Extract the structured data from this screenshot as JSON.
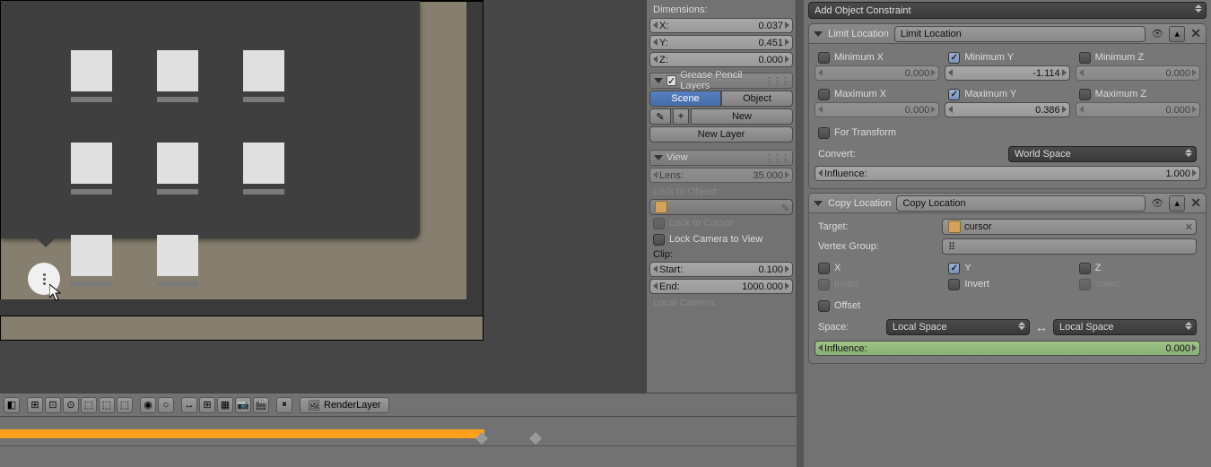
{
  "viewport": {
    "more_icon": "more-options"
  },
  "toolbar": {
    "render_layer": "RenderLayer"
  },
  "n_panel": {
    "dimensions_label": "Dimensions:",
    "dim_x_label": "X:",
    "dim_x_val": "0.037",
    "dim_y_label": "Y:",
    "dim_y_val": "0.451",
    "dim_z_label": "Z:",
    "dim_z_val": "0.000",
    "gp_header": "Grease Pencil Layers",
    "scene_btn": "Scene",
    "object_btn": "Object",
    "new_btn": "New",
    "new_layer_btn": "New Layer",
    "view_header": "View",
    "lens_label": "Lens:",
    "lens_val": "35.000",
    "lock_to_object": "Lock to Object:",
    "lock_to_cursor": "Lock to Cursor",
    "lock_camera": "Lock Camera to View",
    "clip_label": "Clip:",
    "clip_start_label": "Start:",
    "clip_start_val": "0.100",
    "clip_end_label": "End:",
    "clip_end_val": "1000.000",
    "local_camera_label": "Local Camera:"
  },
  "prop": {
    "add_constraint": "Add Object Constraint",
    "limit_loc": {
      "type_label": "Limit Location",
      "name_val": "Limit Location",
      "min_x": "Minimum X",
      "min_x_val": "0.000",
      "min_y": "Minimum Y",
      "min_y_val": "-1.114",
      "min_z": "Minimum Z",
      "min_z_val": "0.000",
      "max_x": "Maximum X",
      "max_x_val": "0.000",
      "max_y": "Maximum Y",
      "max_y_val": "0.386",
      "max_z": "Maximum Z",
      "max_z_val": "0.000",
      "for_transform": "For Transform",
      "convert_label": "Convert:",
      "convert_val": "World Space",
      "influence_label": "Influence:",
      "influence_val": "1.000"
    },
    "copy_loc": {
      "type_label": "Copy Location",
      "name_val": "Copy Location",
      "target_label": "Target:",
      "target_val": "cursor",
      "vgroup_label": "Vertex Group:",
      "x_label": "X",
      "y_label": "Y",
      "z_label": "Z",
      "invert_x": "Invert",
      "invert_y": "Invert",
      "invert_z": "Invert",
      "offset_label": "Offset",
      "space_label": "Space:",
      "space_from": "Local Space",
      "space_to": "Local Space",
      "influence_label": "Influence:",
      "influence_val": "0.000"
    }
  }
}
